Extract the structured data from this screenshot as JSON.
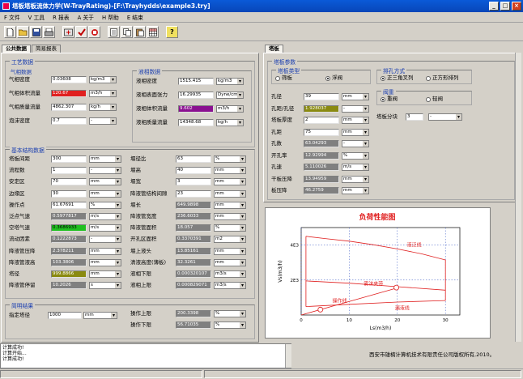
{
  "window": {
    "title": "塔板塔板流体力学(W-TrayRating)-[F:\\Trayhydds\\example3.try]"
  },
  "menu": [
    "F 文件",
    "V 工具",
    "R 报表",
    "A 关于",
    "H 帮助",
    "E 结束"
  ],
  "toolbar_icons": [
    "new-icon",
    "open-icon",
    "save-icon",
    "print-icon",
    "calc-icon",
    "check-icon",
    "stop-icon",
    "report-icon",
    "copy-icon",
    "paste-icon",
    "table-icon",
    "help-icon"
  ],
  "left_tabs": [
    "公共数据",
    "简易报表"
  ],
  "right_tabs": [
    "塔板"
  ],
  "process": {
    "title": "工艺数据",
    "gas": {
      "title": "气相数据",
      "rows": [
        {
          "label": "气相密度",
          "value": "0.03608",
          "unit": "kg/m3"
        },
        {
          "label": "气相体积流量",
          "value": "120.67",
          "unit": "m3/h"
        },
        {
          "label": "气相质量流量",
          "value": "4862.307",
          "unit": "kg/h"
        },
        {
          "label": "泡沫密度",
          "value": "0.7",
          "unit": "-"
        }
      ]
    },
    "liquid": {
      "title": "液相数据",
      "rows": [
        {
          "label": "液相密度",
          "value": "1515.415",
          "unit": "kg/m3"
        },
        {
          "label": "液相表面张力",
          "value": "16.29935",
          "unit": "Dyne/cm"
        },
        {
          "label": "液相体积流量",
          "value": "9.602",
          "unit": "m3/h"
        },
        {
          "label": "液相质量流量",
          "value": "14348.68",
          "unit": "kg/h"
        }
      ]
    }
  },
  "structure": {
    "title": "基本结构数据",
    "left": [
      {
        "label": "塔板间距",
        "value": "300",
        "unit": "mm"
      },
      {
        "label": "流程数",
        "value": "1",
        "unit": "-"
      },
      {
        "label": "安定区",
        "value": "70",
        "unit": "mm"
      },
      {
        "label": "边缘区",
        "value": "30",
        "unit": "mm"
      },
      {
        "label": "操作点",
        "value": "61.67691",
        "unit": "%"
      },
      {
        "label": "泛点气速",
        "value": "0.5977817",
        "unit": "m/s"
      },
      {
        "label": "空塔气速",
        "value": "0.3686933",
        "unit": "m/s"
      },
      {
        "label": "流动因素",
        "value": "0.1222873",
        "unit": "-"
      },
      {
        "label": "降液管压降",
        "value": "2.378211",
        "unit": "mm"
      },
      {
        "label": "降液管液高",
        "value": "103.3806",
        "unit": "mm"
      },
      {
        "label": "塔径",
        "value": "999.8866",
        "unit": "mm"
      },
      {
        "label": "降液管停留",
        "value": "10.2026",
        "unit": "s"
      }
    ],
    "right": [
      {
        "label": "堰径比",
        "value": "63",
        "unit": "%"
      },
      {
        "label": "堰高",
        "value": "40",
        "unit": "mm"
      },
      {
        "label": "堰宽",
        "value": "3",
        "unit": "mm"
      },
      {
        "label": "降液管结构间隙",
        "value": "23",
        "unit": "mm"
      },
      {
        "label": "堰长",
        "value": "649.9898",
        "unit": "mm"
      },
      {
        "label": "降液管宽度",
        "value": "236.6033",
        "unit": "mm"
      },
      {
        "label": "降液管面积",
        "value": "18.057",
        "unit": "%"
      },
      {
        "label": "开孔区面积",
        "value": "0.3370391",
        "unit": "m2"
      },
      {
        "label": "堰上液头",
        "value": "13.85161",
        "unit": "mm"
      },
      {
        "label": "清液高度(薄板)",
        "value": "32.3261",
        "unit": "mm"
      },
      {
        "label": "液相下限",
        "value": "0.000320107",
        "unit": "m3/s"
      },
      {
        "label": "液相上限",
        "value": "0.000829071",
        "unit": "m3/s"
      }
    ]
  },
  "results": {
    "title": "简明结果",
    "diameter_label": "指定塔径",
    "diameter_value": "1000",
    "diameter_unit": "mm",
    "rows": [
      {
        "label": "操作上限",
        "value": "200.3398",
        "unit": "%"
      },
      {
        "label": "操作下限",
        "value": "56.71035",
        "unit": "%"
      }
    ]
  },
  "tray": {
    "title": "塔板参数",
    "type_title": "塔板类型",
    "type_options": [
      "筛板",
      "浮阀"
    ],
    "type_selected": 1,
    "hole_title": "排孔方式",
    "hole_options": [
      "正三角叉列",
      "正方形排列"
    ],
    "hole_selected": 0,
    "valve_title": "阀重",
    "valve_options": [
      "重阀",
      "轻阀"
    ],
    "valve_selected": 0,
    "rows": [
      {
        "label": "孔径",
        "value": "39",
        "unit": "mm"
      },
      {
        "label": "孔距/孔径",
        "value": "1.928037",
        "unit": "-"
      },
      {
        "label": "塔板厚度",
        "value": "2",
        "unit": "mm"
      },
      {
        "label": "孔距",
        "value": "75",
        "unit": "mm"
      },
      {
        "label": "孔数",
        "value": "63.04293",
        "unit": "-"
      },
      {
        "label": "开孔率",
        "value": "12.92994",
        "unit": "%"
      },
      {
        "label": "孔速",
        "value": "5.110026",
        "unit": "m/s"
      },
      {
        "label": "干板压降",
        "value": "13.94959",
        "unit": "mm"
      },
      {
        "label": "板压降",
        "value": "46.2759",
        "unit": "mm"
      }
    ],
    "block_label": "塔板分块",
    "block_value": "3",
    "block_unit": "-"
  },
  "chart_data": {
    "type": "line",
    "title": "负荷性能图",
    "xlabel": "Ls(m3/h)",
    "ylabel": "Vs(m3/h)",
    "xlim": [
      0,
      33
    ],
    "ylim": [
      0,
      5000
    ],
    "xticks": [
      0,
      10,
      20,
      30
    ],
    "yticks": [
      {
        "v": 2000,
        "label": "2E3"
      },
      {
        "v": 4000,
        "label": "4E3"
      }
    ],
    "series": [
      {
        "name": "液泛线",
        "points": [
          [
            1,
            4500
          ],
          [
            5,
            4370
          ],
          [
            10,
            4220
          ],
          [
            15,
            4020
          ],
          [
            20,
            3780
          ],
          [
            25,
            3500
          ],
          [
            30,
            3150
          ]
        ]
      },
      {
        "name": "雾沫夹带",
        "points": [
          [
            1,
            1950
          ],
          [
            10,
            1820
          ],
          [
            20,
            1620
          ],
          [
            30,
            1420
          ]
        ]
      },
      {
        "name": "漏液线",
        "points": [
          [
            1,
            480
          ],
          [
            10,
            610
          ],
          [
            20,
            740
          ],
          [
            30,
            830
          ]
        ]
      },
      {
        "points": [
          [
            1,
            4500
          ],
          [
            1,
            480
          ]
        ]
      },
      {
        "points": [
          [
            30,
            3150
          ],
          [
            30,
            830
          ]
        ]
      },
      {
        "name": "操作线",
        "points": [
          [
            0,
            0
          ],
          [
            20,
            1550
          ]
        ]
      }
    ],
    "points": [
      {
        "x": 4,
        "y": 310
      },
      {
        "x": 19.8,
        "y": 1570
      }
    ],
    "annotations": [
      {
        "text": "液泛线",
        "x": 22,
        "y": 3920
      },
      {
        "text": "雾沫夹带",
        "x": 13,
        "y": 1680
      },
      {
        "text": "操作线",
        "x": 6.5,
        "y": 720
      },
      {
        "text": "漏液线",
        "x": 19.5,
        "y": 310
      }
    ]
  },
  "log": [
    "计算成功!",
    "计算开始...",
    "计算成功!"
  ],
  "company": "西安市雄楠计算机技术有限责任公司版权所有,2010。"
}
